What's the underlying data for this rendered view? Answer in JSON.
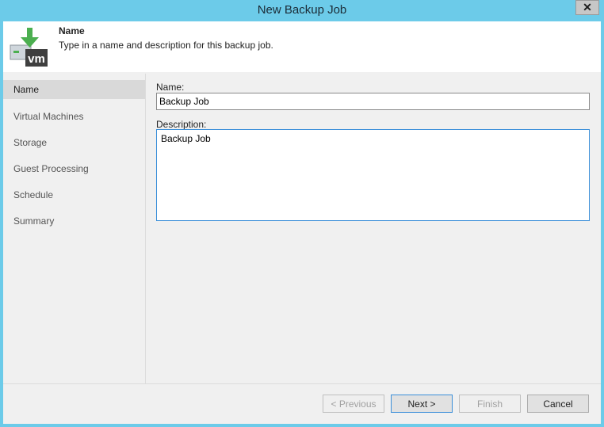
{
  "window": {
    "title": "New Backup Job"
  },
  "header": {
    "title": "Name",
    "description": "Type in a name and description for this backup job.",
    "icon": "vm-backup-icon"
  },
  "sidebar": {
    "items": [
      {
        "label": "Name",
        "active": true
      },
      {
        "label": "Virtual Machines"
      },
      {
        "label": "Storage"
      },
      {
        "label": "Guest Processing"
      },
      {
        "label": "Schedule"
      },
      {
        "label": "Summary"
      }
    ]
  },
  "form": {
    "name_label": "Name:",
    "name_value": "Backup Job",
    "description_label": "Description:",
    "description_value": "Backup Job"
  },
  "buttons": {
    "previous": "< Previous",
    "next": "Next >",
    "finish": "Finish",
    "cancel": "Cancel"
  },
  "colors": {
    "titlebar": "#6ccbe9",
    "accent_green": "#4caf50",
    "focus_blue": "#3b8fd9"
  }
}
